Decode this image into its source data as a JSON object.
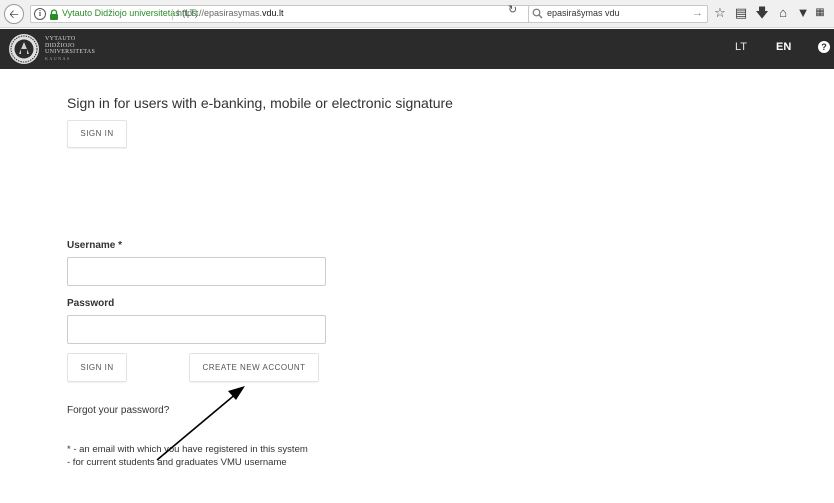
{
  "browser": {
    "site_identity": "Vytauto Didžiojo universitetas (LT)",
    "url_prefix": "https://epasirasymas.",
    "url_domain": "vdu.lt",
    "search_value": "epasirašymas vdu"
  },
  "header": {
    "logo_lines": [
      "VYTAUTO",
      "DIDŽIOJO",
      "UNIVERSITETAS",
      "KAUNAS"
    ],
    "lang_lt": "LT",
    "lang_en": "EN",
    "help": "?"
  },
  "esign": {
    "heading": "Sign in for users with e-banking, mobile or electronic signature",
    "signin_label": "SIGN IN"
  },
  "login": {
    "username_label": "Username *",
    "password_label": "Password",
    "signin_label": "SIGN IN",
    "create_account_label": "CREATE NEW ACCOUNT",
    "forgot_password": "Forgot your password?"
  },
  "notes": {
    "line1": "* - an email with which you have registered in this system",
    "line2": "- for current students and graduates VMU username"
  },
  "colors": {
    "header_bg": "#2b2b2b",
    "secure_green": "#2a8b2a"
  }
}
